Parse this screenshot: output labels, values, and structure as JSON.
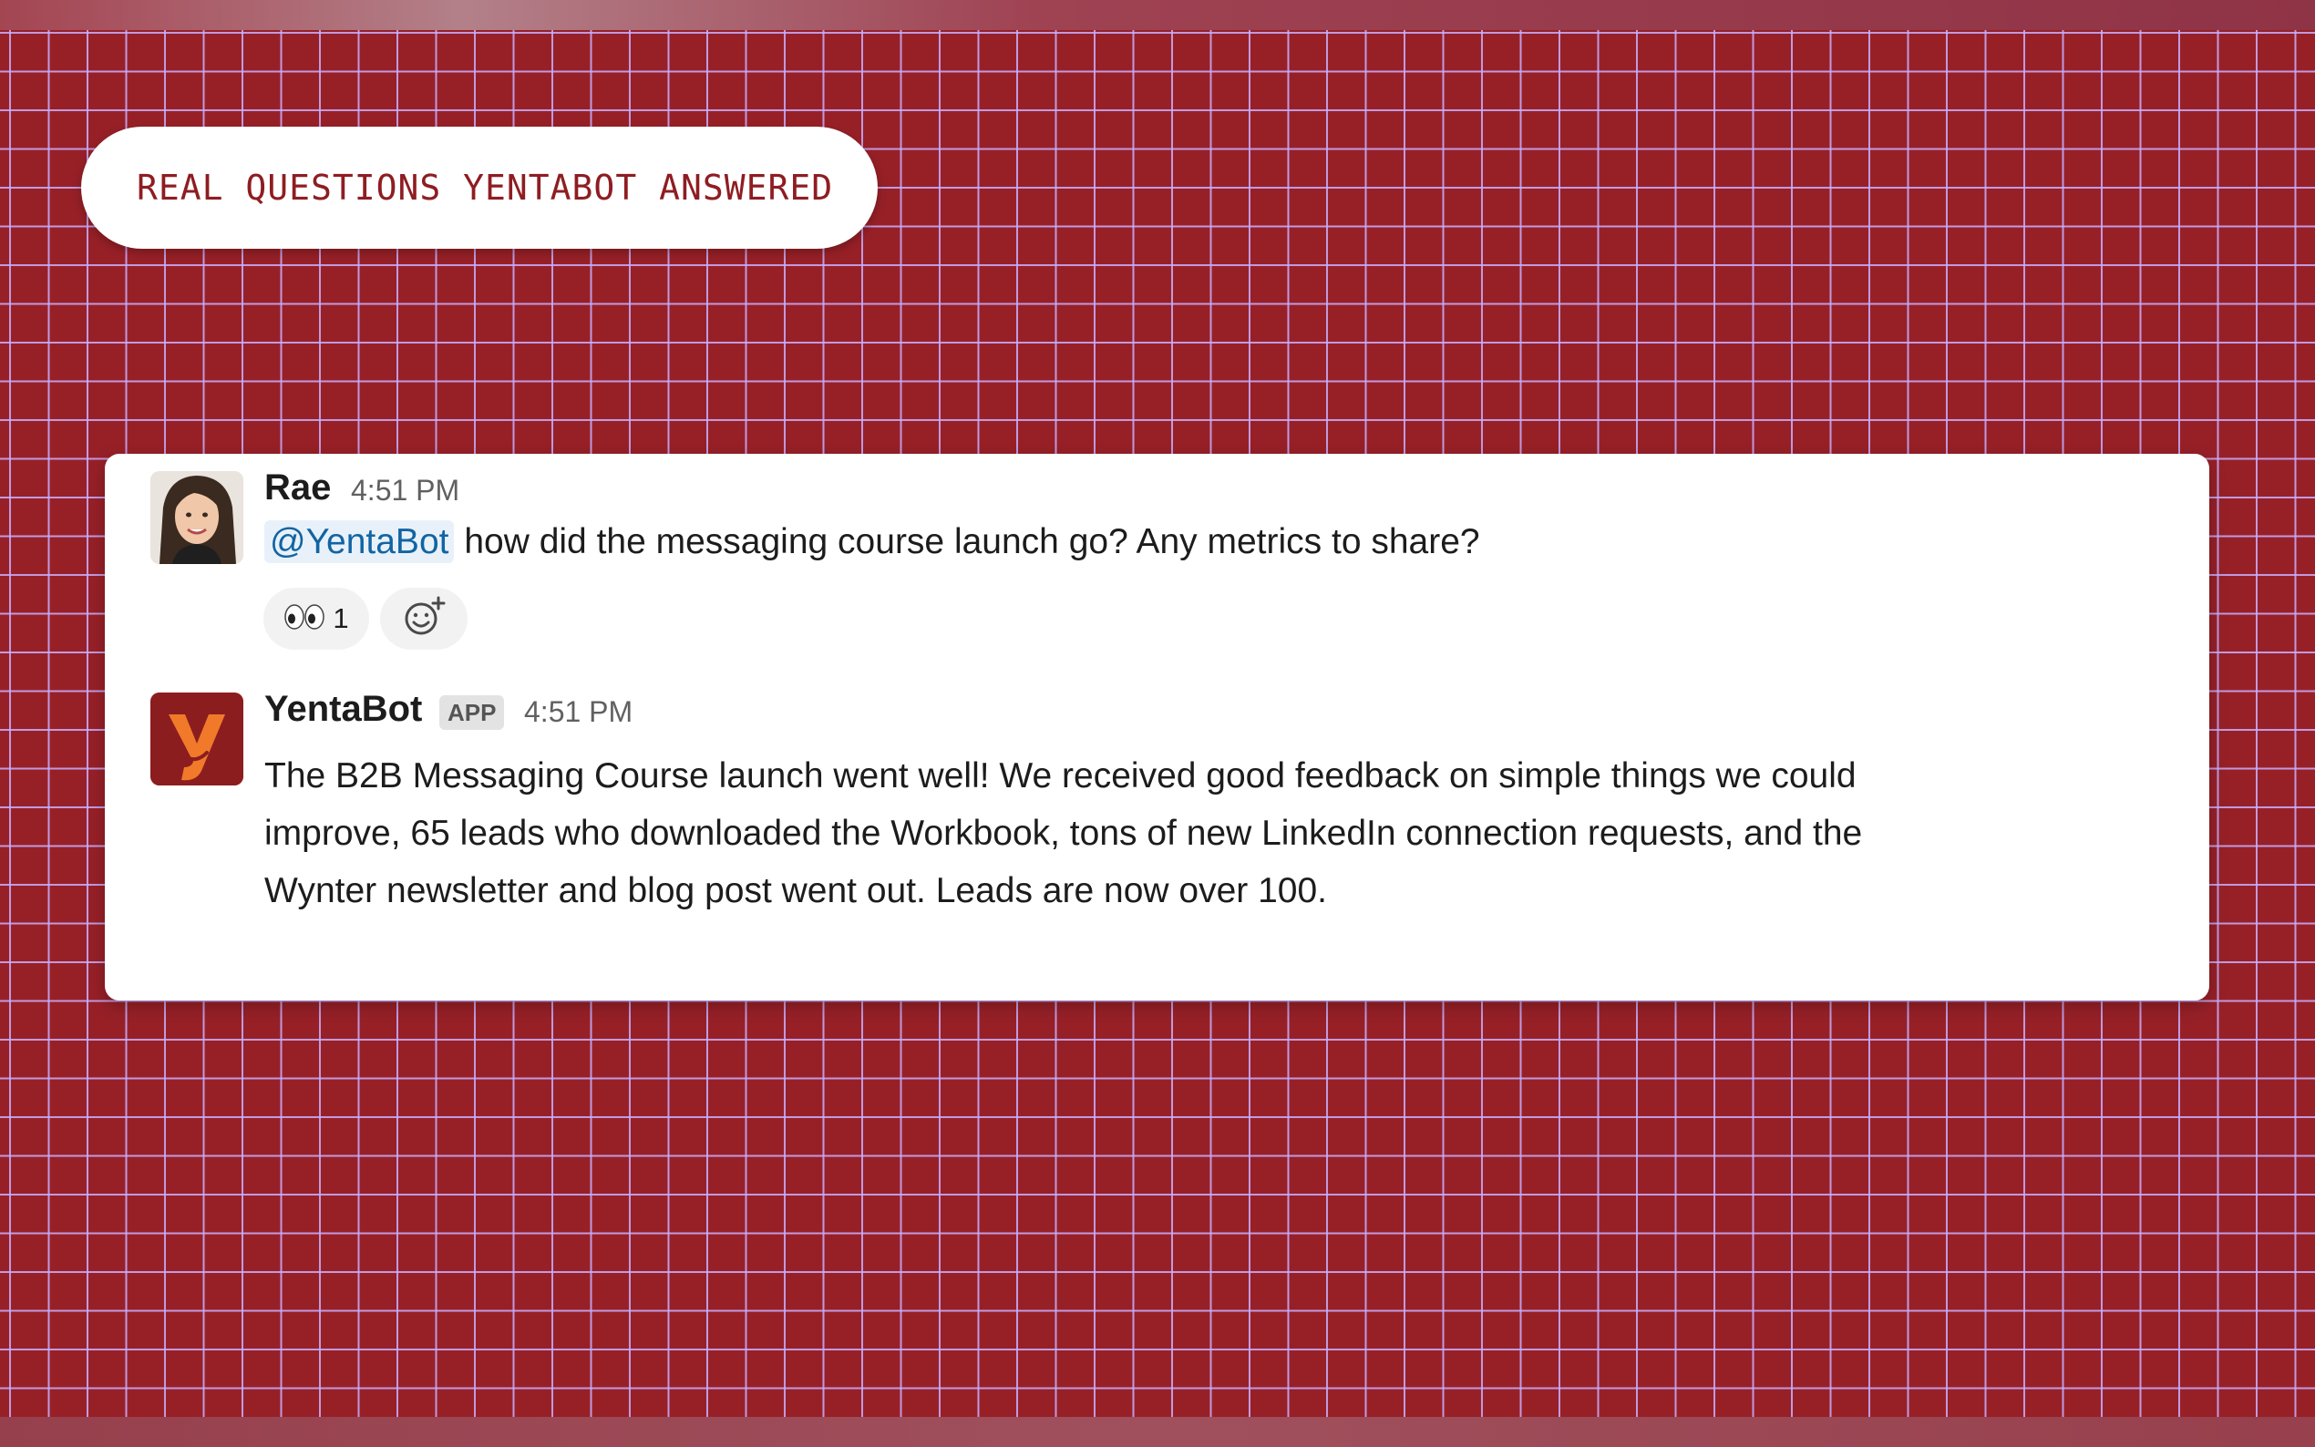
{
  "badge": {
    "text": "REAL QUESTIONS YENTABOT ANSWERED"
  },
  "messages": [
    {
      "author": "Rae",
      "time": "4:51 PM",
      "mention": "@YentaBot",
      "text": "how did the messaging course launch go? Any metrics to share?",
      "reactions": [
        {
          "emoji_icon": "eyes-emoji-icon",
          "count": "1"
        }
      ]
    },
    {
      "author": "YentaBot",
      "tag": "APP",
      "time": "4:51 PM",
      "text": "The B2B Messaging Course launch went well! We received good feedback on simple things we could improve, 65 leads who downloaded the Workbook, tons of new LinkedIn connection requests, and the Wynter newsletter and blog post went out. Leads are now over 100."
    }
  ],
  "colors": {
    "background": "#972027",
    "grid": "#c8afff",
    "badge_text": "#8e1d22",
    "mention_bg": "#e8f1f9",
    "mention_text": "#1264a3",
    "bot_logo_bg": "#8c1d1f",
    "bot_logo_letter": "#f07a2a"
  },
  "icons": {
    "add_reaction": "add-reaction-icon",
    "bot_logo": "yentabot-logo-icon"
  }
}
